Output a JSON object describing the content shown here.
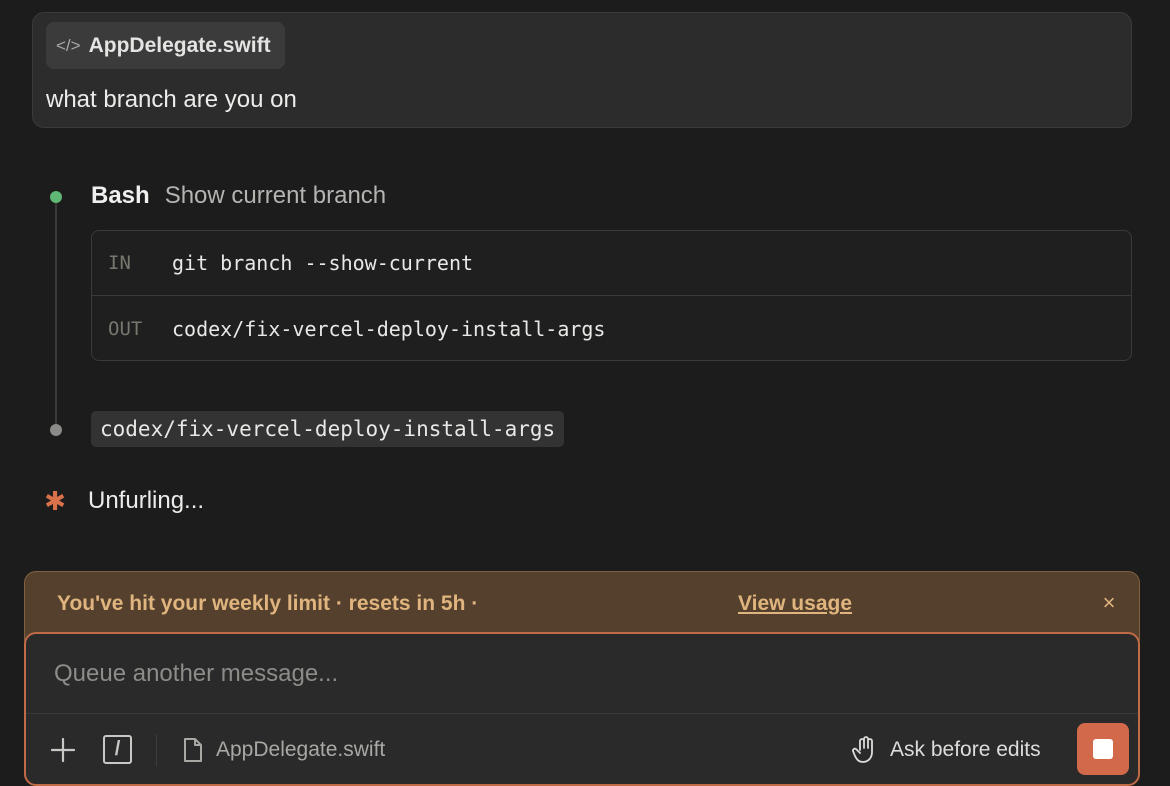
{
  "user_message": {
    "file_chip": {
      "icon": "code-icon",
      "icon_glyph": "</>",
      "filename": "AppDelegate.swift"
    },
    "text": "what branch are you on"
  },
  "tool_call": {
    "status_color": "#5fb873",
    "name": "Bash",
    "description": "Show current branch",
    "input_label": "IN",
    "input": "git branch --show-current",
    "output_label": "OUT",
    "output": "codex/fix-vercel-deploy-install-args"
  },
  "assistant_reply": {
    "text": "codex/fix-vercel-deploy-install-args"
  },
  "status": {
    "icon": "asterisk-icon",
    "glyph": "✱",
    "color": "#d9714a",
    "text": "Unfurling..."
  },
  "limit_banner": {
    "message": "You've hit your weekly limit · resets in 5h ·",
    "link_label": "View usage",
    "close_glyph": "×",
    "color": "#e0b47e"
  },
  "composer": {
    "placeholder": "Queue another message...",
    "value": "",
    "add_icon": "plus-icon",
    "add_glyph": "+",
    "slash_icon": "slash-command-icon",
    "slash_glyph": "/",
    "file_ref": {
      "icon": "file-icon",
      "label": "AppDelegate.swift"
    },
    "mode": {
      "icon": "hand-icon",
      "label": "Ask before edits"
    },
    "stop_button": {
      "icon": "stop-icon",
      "color": "#d1694a"
    },
    "accent_color": "#c06a46"
  }
}
